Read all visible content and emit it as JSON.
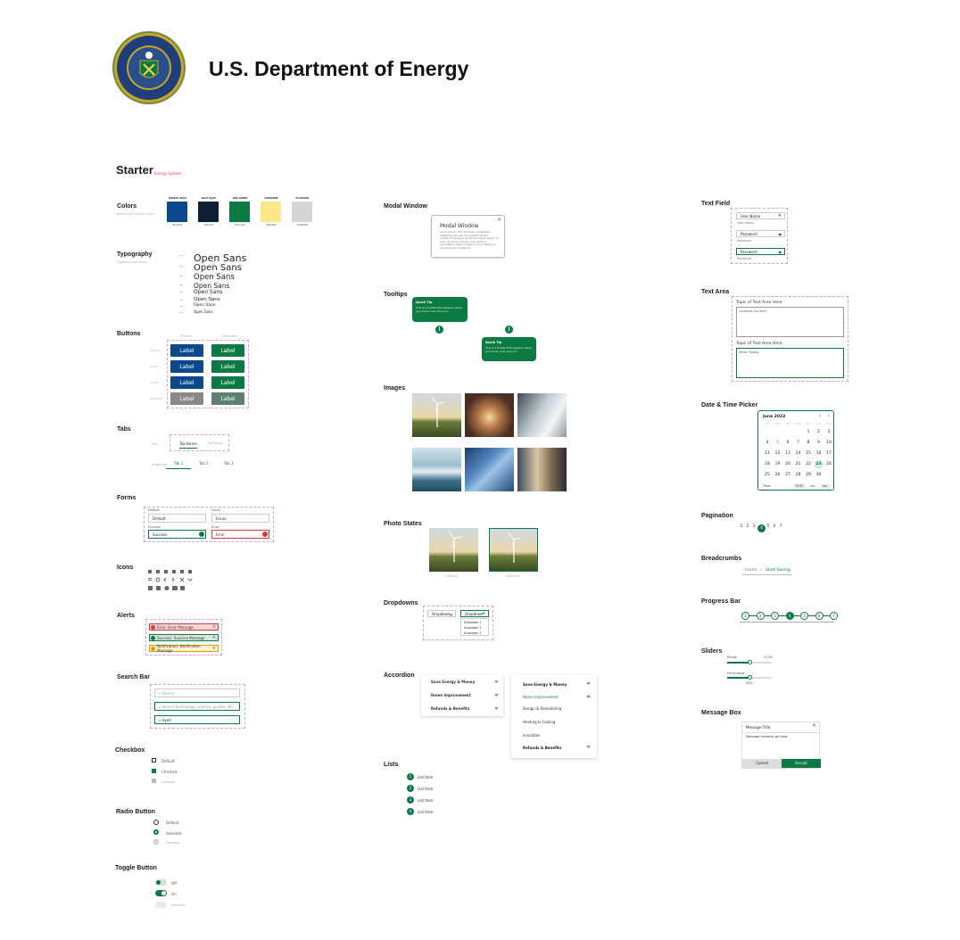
{
  "header": {
    "title": "U.S. Department of Energy",
    "seal_text": "DEPARTMENT OF ENERGY · UNITED STATES OF AMERICA"
  },
  "starter": {
    "title": "Starter",
    "subtitle": "Energy System"
  },
  "sections": {
    "colors": "Colors",
    "typography": "Typography",
    "buttons": "Buttons",
    "tabs": "Tabs",
    "forms": "Forms",
    "icons": "Icons",
    "alerts": "Alerts",
    "search": "Search Bar",
    "checkbox": "Checkbox",
    "radio": "Radio Button",
    "toggle": "Toggle Button",
    "modal": "Modal Window",
    "tooltips": "Tooltips",
    "images": "Images",
    "photo_states": "Photo States",
    "dropdowns": "Dropdowns",
    "accordion": "Accordion",
    "lists": "Lists",
    "text_field": "Text Field",
    "text_area": "Text Area",
    "date_picker": "Date & Time Picker",
    "pagination": "Pagination",
    "breadcrumbs": "Breadcrumbs",
    "progress": "Progress Bar",
    "sliders": "Sliders",
    "message_box": "Message Box"
  },
  "colors": {
    "desc": "Brand and accent colors",
    "swatches": [
      {
        "name": "ENERGY BLUE",
        "hex": "#0a4a8c"
      },
      {
        "name": "NAVY BLUE",
        "hex": "#0f1f33"
      },
      {
        "name": "DOE GREEN",
        "hex": "#0c7a43"
      },
      {
        "name": "SUNSHINE",
        "hex": "#fde68a"
      },
      {
        "name": "PLATINUM",
        "hex": "#d6d6d6"
      }
    ]
  },
  "typography": {
    "desc": "Typeface and sizes",
    "sample": "Open Sans"
  },
  "buttons": {
    "label": "Label",
    "col1": "Primary",
    "col2": "Secondary",
    "rows": [
      "Default",
      "Hover",
      "Active",
      "Disabled"
    ]
  },
  "tabs": {
    "tab_name": "Tab Name",
    "tab_name2": "Tab Name",
    "tab1": "Tab 1",
    "tab2": "Tab 2",
    "tab3": "Tab 3",
    "row1": "Text",
    "row2": "Underline"
  },
  "forms": {
    "default_label": "Default",
    "default_val": "Default",
    "focus_label": "Focus",
    "focus_val": "Focus",
    "success_label": "Success",
    "success_val": "Success",
    "error_label": "Error",
    "error_val": "Error"
  },
  "alerts": {
    "error": "Error: Error Message",
    "success": "Success: Success Message",
    "notice": "Notification: Notification Message",
    "colors": {
      "error": "#f8d7da",
      "success": "#d4edda",
      "notice": "#fff3cd"
    }
  },
  "search": {
    "p1": "Search",
    "p2": "Search technology, science, guides, etc",
    "p3": "Hyell"
  },
  "checkbox": {
    "default": "Default",
    "checked": "Checked",
    "disabled": "Disabled"
  },
  "radio": {
    "default": "Default",
    "selected": "Selected",
    "disabled": "Disabled"
  },
  "toggle": {
    "off": "Off",
    "on": "On",
    "disabled": "Disabled"
  },
  "modal": {
    "title": "Modal Window",
    "body": "Lorem ipsum dolor sit amet, consectetur adipiscing elit, sed do eiusmod tempor incididunt ut labore et dolore magna aliqua. Ut enim ad minim veniam, quis nostrud exercitation ullamco laboris nisi ut aliquip ex ea commodo consequat."
  },
  "tooltips": {
    "t1_title": "Quick Tip",
    "t1_body": "This is a tooltip that appears when you hover over the icon.",
    "t2_title": "Quick Tip",
    "t2_body": "This is a tooltip that appears when you hover over the icon."
  },
  "photo_states": {
    "s1": "Default",
    "s2": "Selected"
  },
  "dropdowns": {
    "d1": "Dropdown",
    "d2": "Dropdown",
    "options": [
      "Dropdown 1",
      "Dropdown 2",
      "Dropdown 3"
    ]
  },
  "accordion": {
    "closed": [
      "Save Energy & Money",
      "Home Improvement",
      "Refunds & Benefits"
    ],
    "open_head1": "Save Energy & Money",
    "open_head2": "Home Improvement",
    "open_items": [
      "Design & Remodeling",
      "Heating & Cooling",
      "Insulation"
    ],
    "open_head3": "Refunds & Benefits"
  },
  "lists": {
    "items": [
      "List Item",
      "List Item",
      "List Item",
      "List Item"
    ]
  },
  "text_field": {
    "user": "User Name",
    "user_help": "User Name",
    "pw": "Password",
    "pw_help": "Password",
    "pw2": "Password",
    "pw2_help": "Password"
  },
  "text_area": {
    "topic1": "Topic of Text Area Here",
    "content1": "Contents Go Here",
    "topic2": "Topic of Text Area Here",
    "content2": "When Typing"
  },
  "date_picker": {
    "month": "June 2023",
    "dows": [
      "SUN",
      "MON",
      "TUE",
      "WED",
      "THU",
      "FRI",
      "SAT"
    ],
    "weeks": [
      [
        "",
        "",
        "",
        "",
        "1",
        "2",
        "3"
      ],
      [
        "4",
        "5",
        "6",
        "7",
        "8",
        "9",
        "10"
      ],
      [
        "11",
        "12",
        "13",
        "14",
        "15",
        "16",
        "17"
      ],
      [
        "18",
        "19",
        "20",
        "21",
        "22",
        "23",
        "24"
      ],
      [
        "25",
        "26",
        "27",
        "28",
        "29",
        "30",
        ""
      ]
    ],
    "time_label": "Time",
    "time_val": "0:00",
    "am": "AM",
    "pm": "PM"
  },
  "pagination": {
    "pages": [
      "1",
      "2",
      "3",
      "4",
      "5",
      "6",
      "7"
    ],
    "current": "4"
  },
  "breadcrumbs": {
    "home": "Home",
    "sep": ">",
    "current": "Start Saving"
  },
  "progress": {
    "steps": [
      "1",
      "2",
      "3",
      "4",
      "5",
      "6",
      "7"
    ],
    "current": 4
  },
  "sliders": {
    "range": "Range",
    "range_max": "5,000",
    "percentage": "Percentage",
    "pct_val": "25%"
  },
  "message_box": {
    "title": "Message Title",
    "body": "Message contents go here.",
    "cancel": "Cancel",
    "accept": "Accept"
  }
}
